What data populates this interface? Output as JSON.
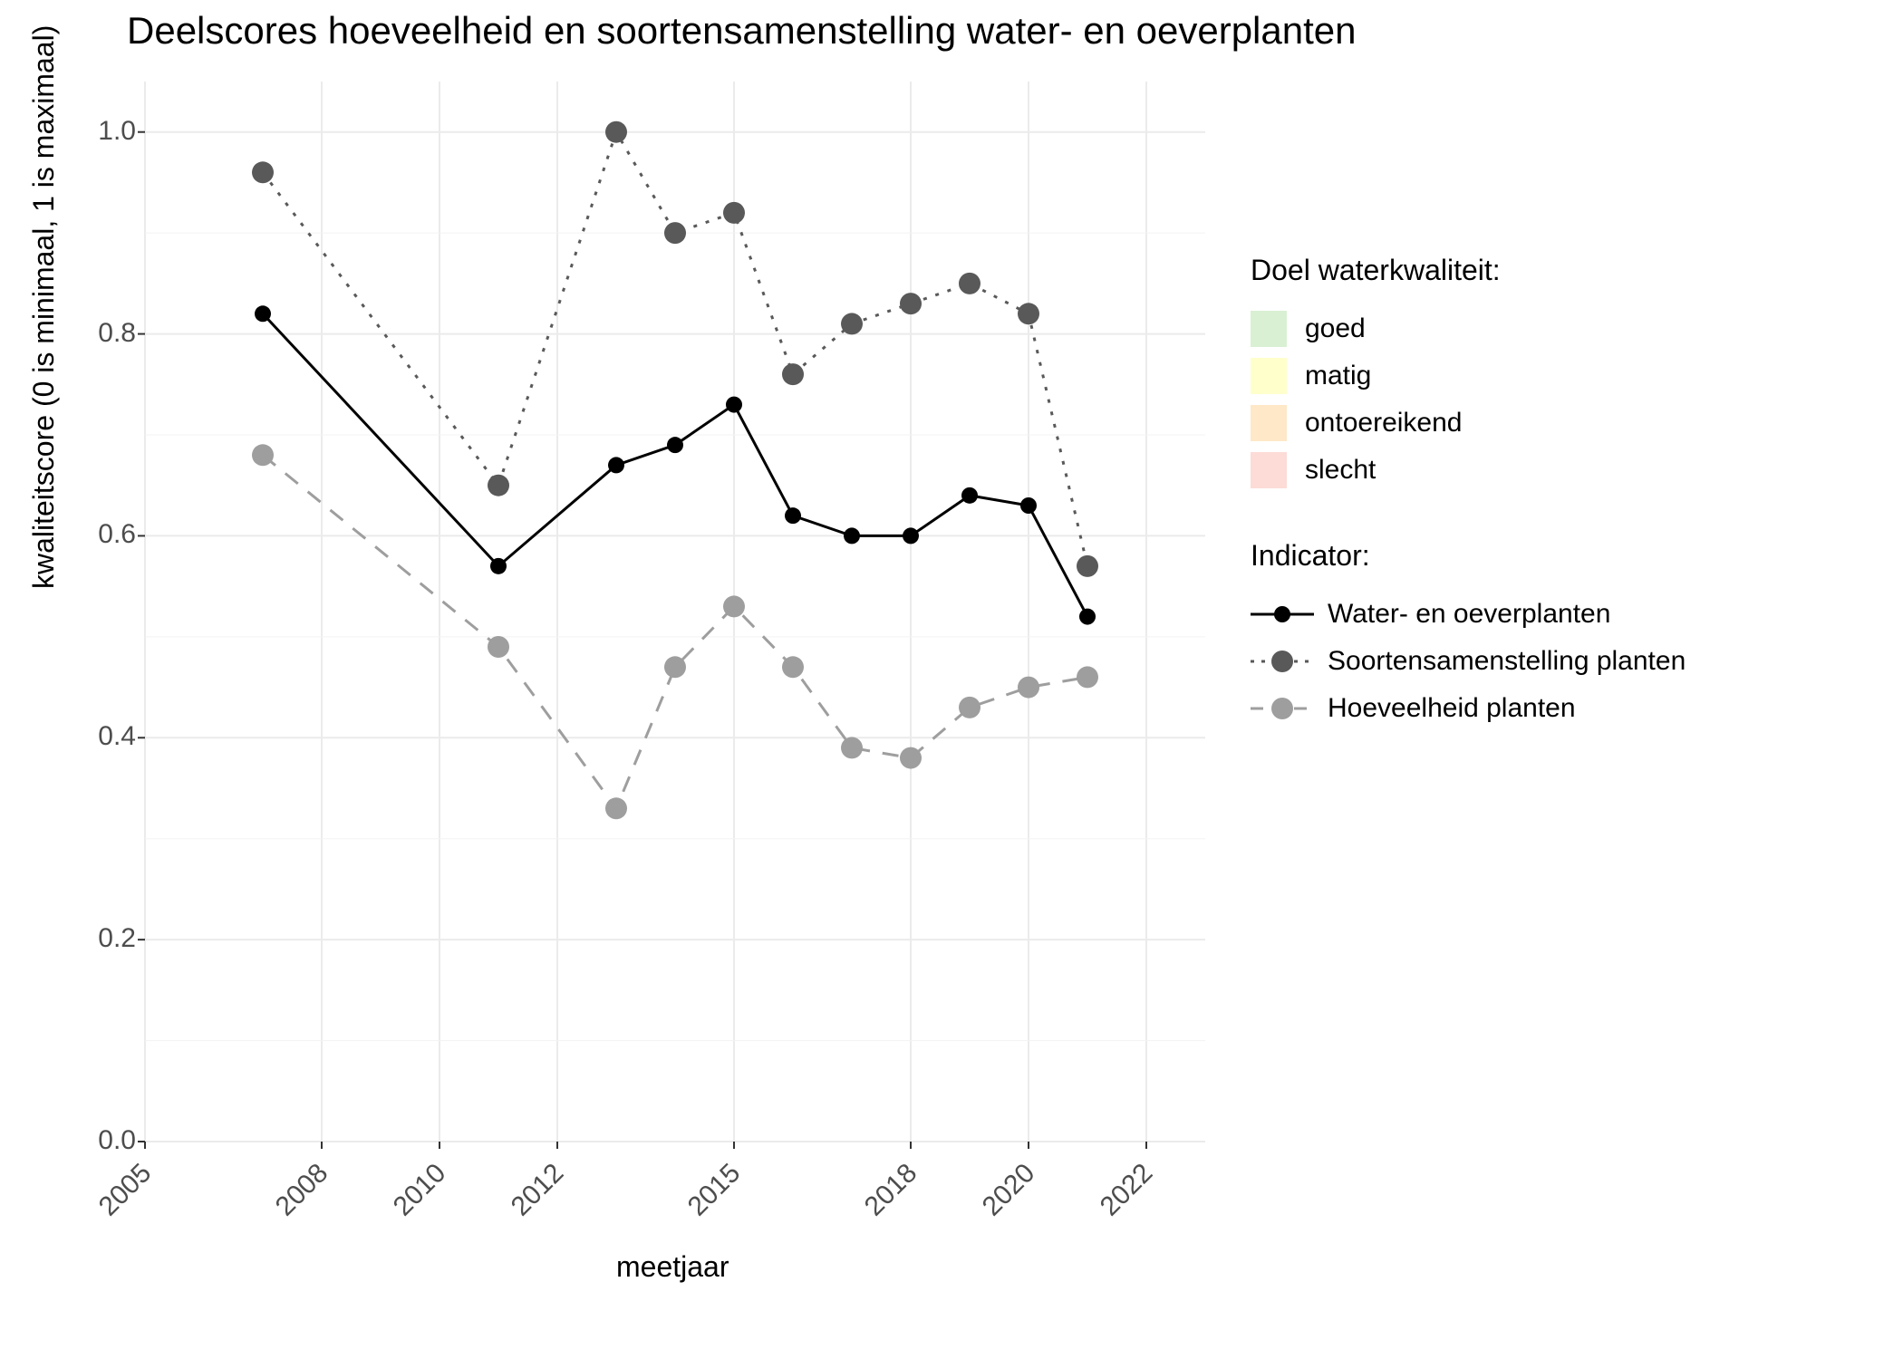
{
  "title": "Deelscores hoeveelheid en soortensamenstelling water- en oeverplanten",
  "xlabel": "meetjaar",
  "ylabel": "kwaliteitscore (0 is minimaal, 1 is maximaal)",
  "legend_quality_title": "Doel waterkwaliteit:",
  "legend_indicator_title": "Indicator:",
  "quality_levels": [
    {
      "label": "goed",
      "color": "#d9f0d3"
    },
    {
      "label": "matig",
      "color": "#ffffcc"
    },
    {
      "label": "ontoereikend",
      "color": "#fee8c8"
    },
    {
      "label": "slecht",
      "color": "#fddbd7"
    }
  ],
  "indicators": [
    {
      "label": "Water- en oeverplanten",
      "color": "#000000",
      "dash": "solid",
      "radius": 9
    },
    {
      "label": "Soortensamenstelling planten",
      "color": "#595959",
      "dash": "dotted",
      "radius": 12
    },
    {
      "label": "Hoeveelheid planten",
      "color": "#9e9e9e",
      "dash": "dashed",
      "radius": 12
    }
  ],
  "x_ticks": [
    2005,
    2008,
    2010,
    2012,
    2015,
    2018,
    2020,
    2022
  ],
  "y_ticks": [
    0.0,
    0.2,
    0.4,
    0.6,
    0.8,
    1.0
  ],
  "chart_data": {
    "type": "line",
    "title": "Deelscores hoeveelheid en soortensamenstelling water- en oeverplanten",
    "xlabel": "meetjaar",
    "ylabel": "kwaliteitscore (0 is minimaal, 1 is maximaal)",
    "xlim": [
      2005,
      2023
    ],
    "ylim": [
      0.0,
      1.05
    ],
    "x": [
      2007,
      2011,
      2013,
      2014,
      2015,
      2016,
      2017,
      2018,
      2019,
      2020,
      2021,
      2022
    ],
    "series": [
      {
        "name": "Water- en oeverplanten",
        "color": "#000000",
        "dash": "solid",
        "values": [
          0.82,
          0.57,
          0.67,
          0.69,
          0.73,
          0.62,
          0.6,
          0.6,
          0.64,
          0.63,
          0.52,
          null
        ]
      },
      {
        "name": "Soortensamenstelling planten",
        "color": "#595959",
        "dash": "dotted",
        "values": [
          0.96,
          0.65,
          1.0,
          0.9,
          0.92,
          0.76,
          0.81,
          0.83,
          0.85,
          0.82,
          0.57,
          null
        ]
      },
      {
        "name": "Hoeveelheid planten",
        "color": "#9e9e9e",
        "dash": "dashed",
        "values": [
          0.68,
          0.49,
          0.33,
          0.47,
          0.53,
          0.47,
          0.39,
          0.38,
          0.43,
          0.45,
          0.46,
          null
        ]
      }
    ],
    "legend_quality": [
      "goed",
      "matig",
      "ontoereikend",
      "slecht"
    ]
  }
}
